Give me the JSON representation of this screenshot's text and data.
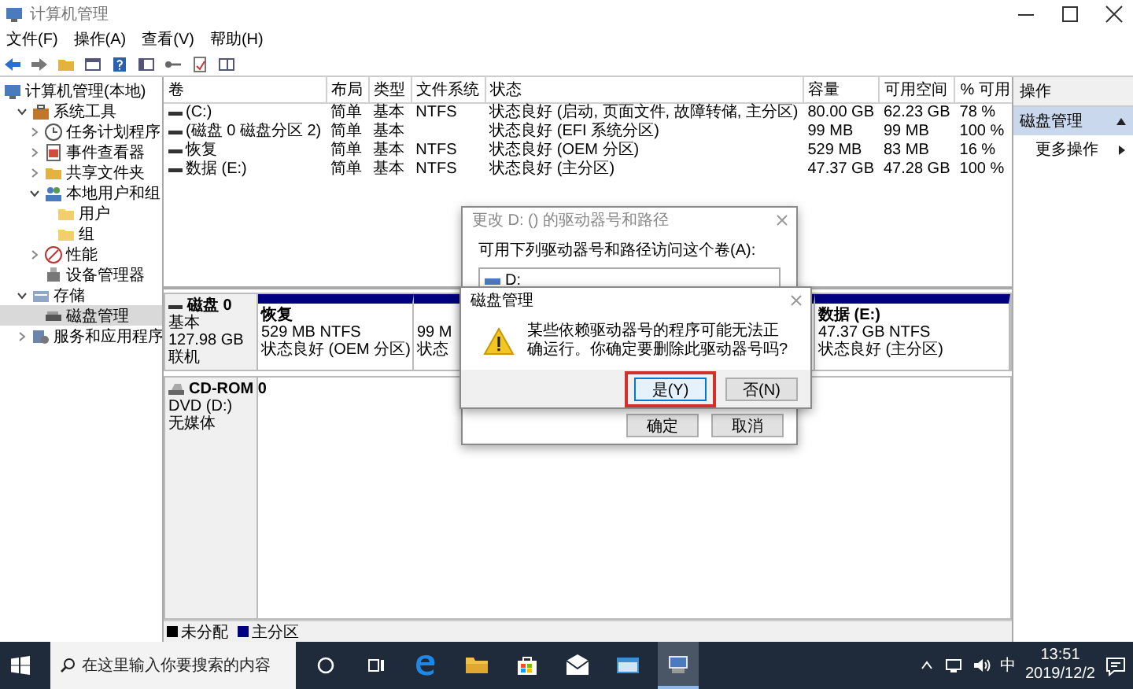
{
  "window": {
    "title": "计算机管理"
  },
  "menu": [
    "文件(F)",
    "操作(A)",
    "查看(V)",
    "帮助(H)"
  ],
  "tree": [
    {
      "label": "计算机管理(本地)",
      "selected": false,
      "children": [
        {
          "label": "系统工具",
          "expanded": true,
          "selected": false,
          "children": [
            {
              "label": "任务计划程序",
              "expanded": false,
              "selected": false
            },
            {
              "label": "事件查看器",
              "expanded": false,
              "selected": false
            },
            {
              "label": "共享文件夹",
              "expanded": false,
              "selected": false
            },
            {
              "label": "本地用户和组",
              "expanded": true,
              "selected": false,
              "children": [
                {
                  "label": "用户",
                  "selected": false
                },
                {
                  "label": "组",
                  "selected": false
                }
              ]
            },
            {
              "label": "性能",
              "expanded": false,
              "selected": false
            },
            {
              "label": "设备管理器",
              "selected": false
            }
          ]
        },
        {
          "label": "存储",
          "expanded": true,
          "selected": false,
          "children": [
            {
              "label": "磁盘管理",
              "selected": true
            }
          ]
        },
        {
          "label": "服务和应用程序",
          "expanded": false,
          "selected": false
        }
      ]
    }
  ],
  "volumes": {
    "columns": [
      "卷",
      "布局",
      "类型",
      "文件系统",
      "状态",
      "容量",
      "可用空间",
      "% 可用"
    ],
    "rows": [
      {
        "volume": "(C:)",
        "layout": "简单",
        "type": "基本",
        "file_system": "NTFS",
        "status": "状态良好 (启动, 页面文件, 故障转储, 主分区)",
        "capacity": "80.00 GB",
        "free": "62.23 GB",
        "percent": "78 %"
      },
      {
        "volume": "(磁盘 0 磁盘分区 2)",
        "layout": "简单",
        "type": "基本",
        "status": "状态良好 (EFI 系统分区)",
        "capacity": "99 MB",
        "free": "99 MB",
        "percent": "100 %"
      },
      {
        "volume": "恢复",
        "layout": "简单",
        "type": "基本",
        "file_system": "NTFS",
        "status": "状态良好 (OEM 分区)",
        "capacity": "529 MB",
        "free": "83 MB",
        "percent": "16 %"
      },
      {
        "volume": "数据 (E:)",
        "layout": "简单",
        "type": "基本",
        "file_system": "NTFS",
        "status": "状态良好 (主分区)",
        "capacity": "47.37 GB",
        "free": "47.28 GB",
        "percent": "100 %"
      }
    ]
  },
  "disks": [
    {
      "kind": "disk",
      "name": "磁盘 0",
      "lines": [
        "基本",
        "127.98 GB",
        "联机"
      ],
      "partitions": [
        {
          "title": "恢复",
          "size": "529 MB NTFS",
          "status": "状态良好 (OEM 分区)"
        },
        {
          "size": "99 M",
          "status": "状态"
        },
        {
          "title": "数据 (E:)",
          "size": "47.37 GB NTFS",
          "status": "状态良好 (主分区)"
        }
      ]
    },
    {
      "kind": "cdrom",
      "name": "CD-ROM 0",
      "lines": [
        "DVD (D:)",
        "无媒体"
      ]
    }
  ],
  "legend": [
    {
      "label": "未分配",
      "color": "#000000"
    },
    {
      "label": "主分区",
      "color": "#000080"
    }
  ],
  "actions": {
    "header": "操作",
    "items": [
      {
        "kind": "section",
        "label": "磁盘管理",
        "selected": true
      },
      {
        "kind": "item",
        "label": "更多操作",
        "selected": false
      }
    ]
  },
  "drive_letter_dialog": {
    "title": "更改 D: () 的驱动器号和路径",
    "label": "可用下列驱动器号和路径访问这个卷(A):",
    "paths": [
      {
        "label": "D:"
      }
    ],
    "buttons": [
      {
        "label": "确定"
      },
      {
        "label": "取消"
      }
    ]
  },
  "confirm_dialog": {
    "title": "磁盘管理",
    "message": "某些依赖驱动器号的程序可能无法正确运行。你确定要删除此驱动器号吗?",
    "buttons": [
      {
        "label": "是(Y)",
        "focused": true,
        "highlighted": true
      },
      {
        "label": "否(N)",
        "focused": false,
        "highlighted": false
      }
    ]
  },
  "taskbar": {
    "search": {
      "placeholder": "在这里输入你要搜索的内容"
    },
    "apps": [
      {
        "kind": "browser",
        "selected": false
      },
      {
        "kind": "folder",
        "selected": false
      },
      {
        "kind": "store",
        "selected": false
      },
      {
        "kind": "mail",
        "selected": false
      },
      {
        "kind": "window",
        "selected": false
      },
      {
        "kind": "management",
        "selected": true
      }
    ],
    "ime": "中",
    "time": "13:51",
    "date": "2019/12/2"
  }
}
